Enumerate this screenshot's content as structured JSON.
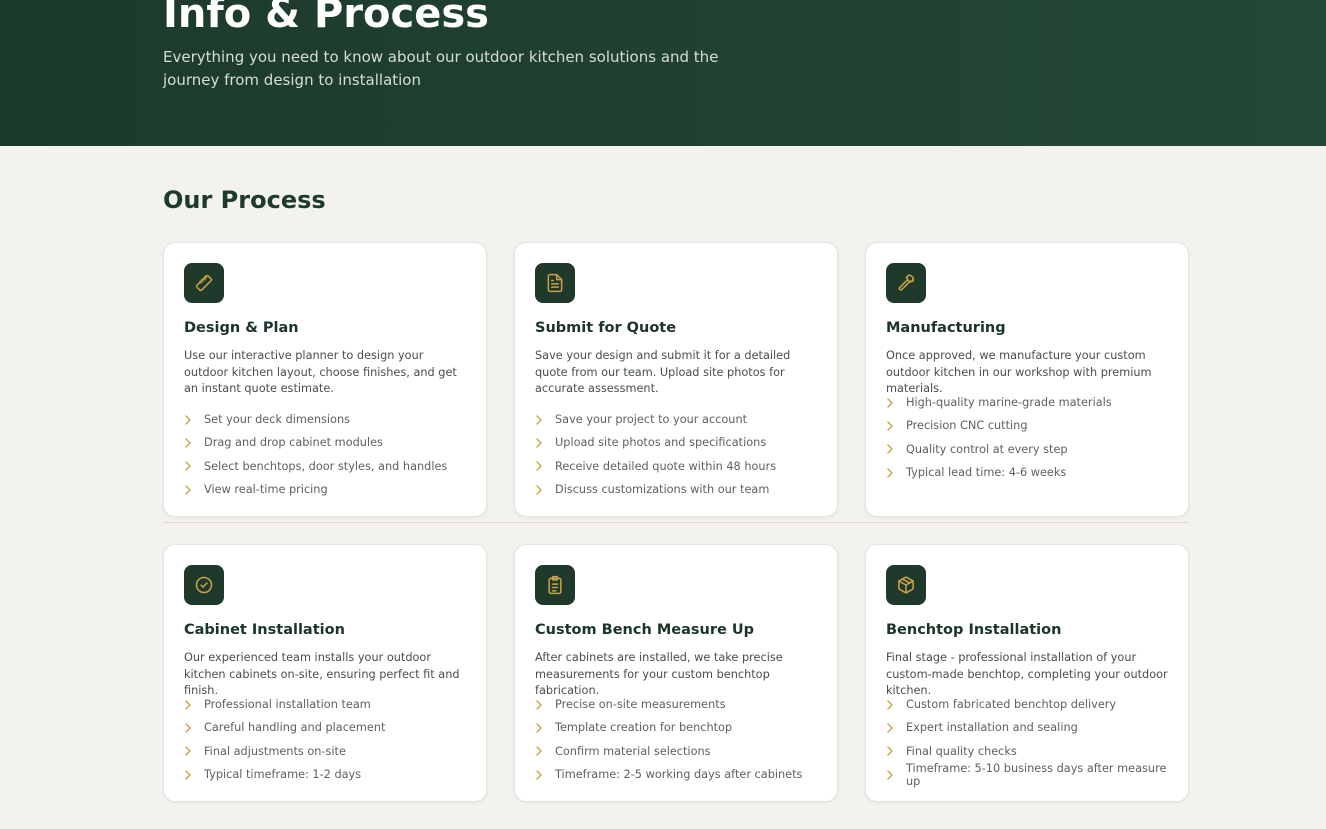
{
  "hero": {
    "title": "Info & Process",
    "subtitle": "Everything you need to know about our outdoor kitchen solutions and the journey from design to installation"
  },
  "process": {
    "title": "Our Process",
    "cards": [
      {
        "icon": "ruler-icon",
        "title": "Design & Plan",
        "description": "Use our interactive planner to design your outdoor kitchen layout, choose finishes, and get an instant quote estimate.",
        "items": [
          "Set your deck dimensions",
          "Drag and drop cabinet modules",
          "Select benchtops, door styles, and handles",
          "View real-time pricing"
        ]
      },
      {
        "icon": "document-icon",
        "title": "Submit for Quote",
        "description": "Save your design and submit it for a detailed quote from our team. Upload site photos for accurate assessment.",
        "items": [
          "Save your project to your account",
          "Upload site photos and specifications",
          "Receive detailed quote within 48 hours",
          "Discuss customizations with our team"
        ]
      },
      {
        "icon": "hammer-icon",
        "title": "Manufacturing",
        "description": "Once approved, we manufacture your custom outdoor kitchen in our workshop with premium materials.",
        "items": [
          "High-quality marine-grade materials",
          "Precision CNC cutting",
          "Quality control at every step",
          "Typical lead time: 4-6 weeks"
        ]
      },
      {
        "icon": "check-circle-icon",
        "title": "Cabinet Installation",
        "description": "Our experienced team installs your outdoor kitchen cabinets on-site, ensuring perfect fit and finish.",
        "items": [
          "Professional installation team",
          "Careful handling and placement",
          "Final adjustments on-site",
          "Typical timeframe: 1-2 days"
        ]
      },
      {
        "icon": "clipboard-icon",
        "title": "Custom Bench Measure Up",
        "description": "After cabinets are installed, we take precise measurements for your custom benchtop fabrication.",
        "items": [
          "Precise on-site measurements",
          "Template creation for benchtop",
          "Confirm material selections",
          "Timeframe: 2-5 working days after cabinets"
        ]
      },
      {
        "icon": "package-icon",
        "title": "Benchtop Installation",
        "description": "Final stage - professional installation of your custom-made benchtop, completing your outdoor kitchen.",
        "items": [
          "Custom fabricated benchtop delivery",
          "Expert installation and sealing",
          "Final quality checks",
          "Timeframe: 5-10 business days after measure up"
        ]
      }
    ]
  },
  "colors": {
    "hero_bg": "#1c3a2a",
    "icon_bg": "#1f3a2a",
    "accent": "#c9a24a",
    "page_bg": "#f3f2ee"
  }
}
